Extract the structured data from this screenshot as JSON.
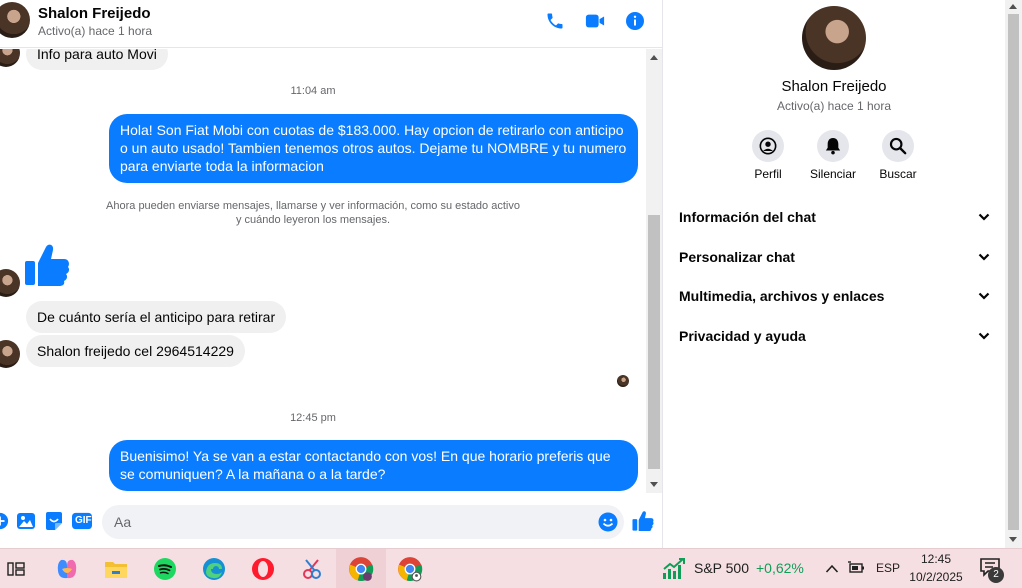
{
  "header": {
    "name": "Shalon Freijedo",
    "status": "Activo(a) hace 1 hora",
    "icons": [
      "phone-icon",
      "video-icon",
      "info-icon"
    ]
  },
  "messages": {
    "partial_top": "Info para auto Movi",
    "ts1": "11:04 am",
    "out1": "Hola! Son Fiat Mobi con cuotas de $183.000. Hay opcion de retirarlo con anticipo o un auto usado! Tambien tenemos otros autos. Dejame tu NOMBRE y tu numero para enviarte toda la informacion",
    "system_line1": "Ahora pueden enviarse mensajes, llamarse y ver información, como su estado activo",
    "system_line2": "y cuándo leyeron los mensajes.",
    "in1": "De cuánto sería el anticipo para retirar",
    "in2": "Shalon freijedo cel 2964514229",
    "ts2": "12:45 pm",
    "out2": "Buenisimo! Ya se van a estar contactando con vos! En que horario preferis que se comuniquen? A la mañana o a la tarde?"
  },
  "composer": {
    "placeholder": "Aa",
    "gif_label": "GIF"
  },
  "info": {
    "name": "Shalon Freijedo",
    "status": "Activo(a) hace 1 hora",
    "actions": [
      {
        "label": "Perfil",
        "icon": "profile-icon"
      },
      {
        "label": "Silenciar",
        "icon": "bell-icon"
      },
      {
        "label": "Buscar",
        "icon": "search-icon"
      }
    ],
    "sections": [
      {
        "label": "Información del chat"
      },
      {
        "label": "Personalizar chat"
      },
      {
        "label": "Multimedia, archivos y enlaces"
      },
      {
        "label": "Privacidad y ayuda"
      }
    ]
  },
  "taskbar": {
    "stock_name": "S&P 500",
    "stock_change": "+0,62%",
    "lang": "ESP",
    "time": "12:45",
    "date": "10/2/2025",
    "notif_count": "2"
  },
  "colors": {
    "messenger_blue": "#0a7cff",
    "bubble_gray": "#f0f0f0",
    "stock_green": "#0f9d58",
    "taskbar_bg": "#f6dfe2"
  }
}
